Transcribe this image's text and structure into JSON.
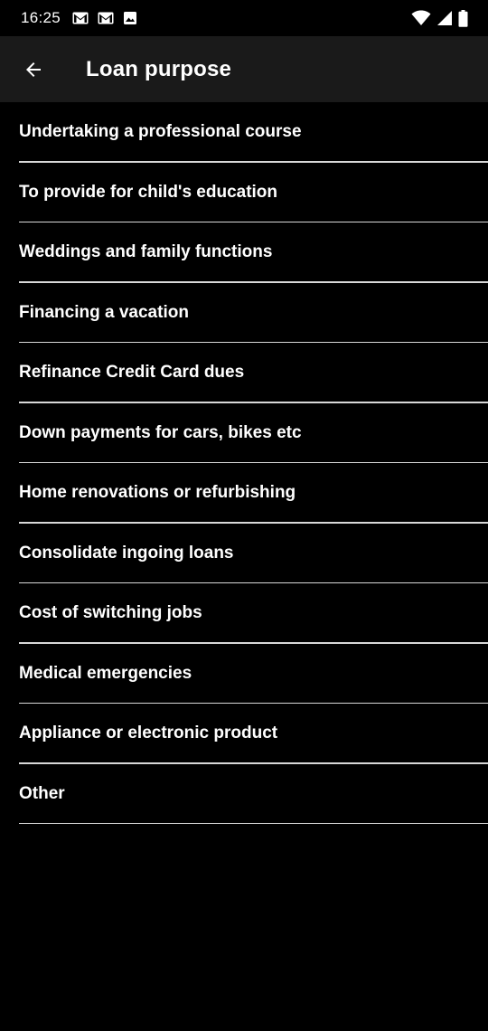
{
  "status_bar": {
    "time": "16:25",
    "left_icons": [
      "gmail-icon",
      "gmail-icon",
      "image-icon"
    ],
    "right_icons": [
      "wifi-icon",
      "cellular-signal-icon",
      "battery-icon"
    ]
  },
  "app_bar": {
    "back_icon": "arrow-back-icon",
    "title": "Loan purpose"
  },
  "loan_purposes": [
    {
      "label": "Undertaking a professional course"
    },
    {
      "label": "To provide for child's education"
    },
    {
      "label": "Weddings and family functions"
    },
    {
      "label": "Financing a vacation"
    },
    {
      "label": "Refinance Credit Card dues"
    },
    {
      "label": "Down payments for cars, bikes etc"
    },
    {
      "label": "Home renovations or refurbishing"
    },
    {
      "label": "Consolidate ingoing loans"
    },
    {
      "label": "Cost of switching jobs"
    },
    {
      "label": "Medical emergencies"
    },
    {
      "label": "Appliance or electronic product"
    },
    {
      "label": "Other"
    }
  ],
  "colors": {
    "background": "#000000",
    "app_bar": "#1a1a1a",
    "text": "#ffffff",
    "divider": "#d8d8d8"
  }
}
